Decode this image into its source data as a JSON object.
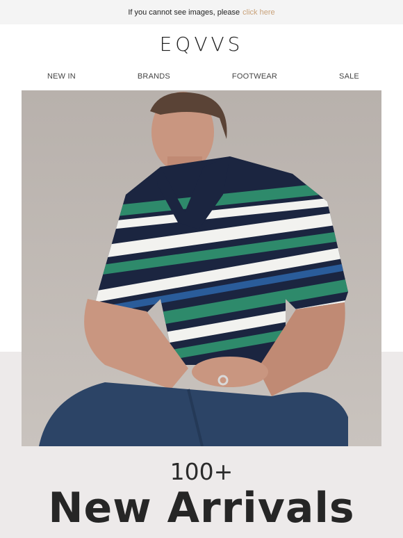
{
  "preheader": {
    "text": "If you cannot see images, please",
    "link_label": "click here",
    "link_color": "#c9a27a"
  },
  "header": {
    "logo": "EQVVS"
  },
  "nav": {
    "items": [
      "NEW IN",
      "BRANDS",
      "FOOTWEAR",
      "SALE"
    ]
  },
  "hero": {
    "image_icon": "model-in-striped-polo-photo"
  },
  "headline": {
    "count": "100+",
    "title": "New Arrivals"
  },
  "colors": {
    "band": "#edeaea",
    "preheader_bg": "#f4f4f4",
    "stripe_green": "#2e8a6b",
    "stripe_navy": "#1b2540"
  }
}
